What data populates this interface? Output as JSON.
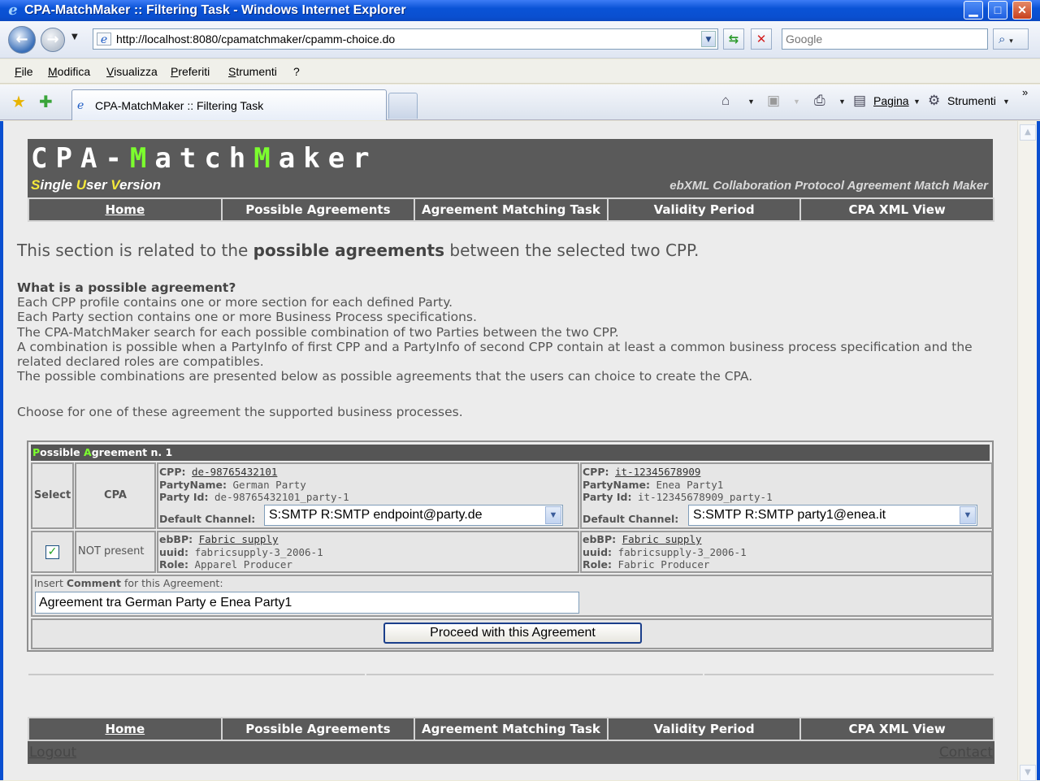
{
  "window": {
    "title": "CPA-MatchMaker :: Filtering Task - Windows Internet Explorer"
  },
  "browser": {
    "url": "http://localhost:8080/cpamatchmaker/cpamm-choice.do",
    "search_placeholder": "Google",
    "menu": [
      "File",
      "Modifica",
      "Visualizza",
      "Preferiti",
      "Strumenti",
      "?"
    ],
    "tab_title": "CPA-MatchMaker :: Filtering Task",
    "cmd_page": "Pagina",
    "cmd_tools": "Strumenti"
  },
  "app": {
    "logo_text": "CPA-MatchMaker",
    "subtitle": "Single User Version",
    "tagline": "ebXML Collaboration Protocol Agreement Match Maker"
  },
  "nav": [
    {
      "label": "Home",
      "link": true
    },
    {
      "label": "Possible Agreements",
      "link": false
    },
    {
      "label": "Agreement Matching Task",
      "link": false
    },
    {
      "label": "Validity Period",
      "link": false
    },
    {
      "label": "CPA XML View",
      "link": false
    }
  ],
  "intro": {
    "before": "This section is related to the ",
    "strong": "possible agreements",
    "after": " between the selected two CPP."
  },
  "description": {
    "question": "What is a possible agreement?",
    "lines": [
      "Each CPP profile contains one or more section for each defined Party.",
      "Each Party section contains one or more Business Process specifications.",
      "The CPA-MatchMaker search for each possible combination of two Parties between the two CPP.",
      "A combination is possible when a PartyInfo of first CPP and a PartyInfo of second CPP contain at least a common business process specification and the related declared roles are compatibles.",
      "The possible combinations are presented below as possible agreements that the users can choice to create the CPA."
    ],
    "choose": "Choose for one of these agreement the supported business processes."
  },
  "agreement": {
    "header": "Possible Agreement n. 1",
    "col_select": "Select",
    "col_cpa": "CPA",
    "labels": {
      "cpp": "CPP:",
      "party_name": "PartyName:",
      "party_id": "Party Id:",
      "default_channel": "Default Channel:",
      "ebbp": "ebBP:",
      "uuid": "uuid:",
      "role": "Role:"
    },
    "left": {
      "cpp": "de-98765432101",
      "party_name": "German Party",
      "party_id": "de-98765432101_party-1",
      "channel": "S:SMTP R:SMTP endpoint@party.de",
      "ebbp": "Fabric supply",
      "uuid": "fabricsupply-3_2006-1",
      "role": "Apparel Producer"
    },
    "right": {
      "cpp": "it-12345678909",
      "party_name": "Enea Party1",
      "party_id": "it-12345678909_party-1",
      "channel": "S:SMTP R:SMTP party1@enea.it",
      "ebbp": "Fabric supply",
      "uuid": "fabricsupply-3_2006-1",
      "role": "Fabric Producer"
    },
    "selected": true,
    "cpa_status": "NOT present",
    "comment_label_pre": "Insert ",
    "comment_label_bold": "Comment",
    "comment_label_post": " for this Agreement:",
    "comment_value": "Agreement tra German Party e Enea Party1",
    "proceed_label": "Proceed with this Agreement"
  },
  "footer": {
    "logout": "Logout",
    "contact": "Contact"
  }
}
